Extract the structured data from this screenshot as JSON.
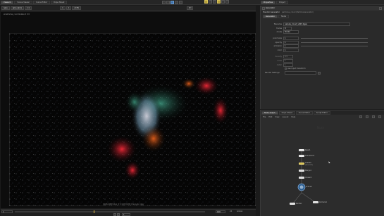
{
  "menubar": {
    "tabs": [
      "Viewer1",
      "Scene Viewer",
      "Curve Editor",
      "Dope Sheet",
      "Pixel Analyzer",
      "Project Settings",
      "Background Render",
      "Script Editor"
    ],
    "right_tabs": [
      "Properties",
      "Project"
    ],
    "frame_field": "1"
  },
  "viewer": {
    "toolbar": {
      "channels": "rgba",
      "channel2": "rgba.alpha",
      "zoom": "1:1",
      "exposure": "1",
      "gamma": "1",
      "colorspace": "ACES",
      "view_mode": "2D"
    },
    "format_label": "wireframe_coordinates 0 0 0",
    "bottom_label": "1920x1080 bbox: 0 0 1920 1080 channels: rgba"
  },
  "timeline": {
    "start": "1",
    "end": "100",
    "current": "1",
    "fps": "24",
    "mode": "Global",
    "playback": "Nuke"
  },
  "properties": {
    "node_name": "Generator",
    "node_type": "Houdini Generator",
    "node_subtitle": "particles_cloud (ParticleGenerator)",
    "tabs": [
      "Generator",
      "Node"
    ],
    "fields": [
      {
        "label": "filename",
        "value": "nebula_cloud_v003.bgeo"
      },
      {
        "label": "frame",
        "value": "0"
      },
      {
        "label": "mode",
        "value": "Points"
      },
      {
        "label": "point size",
        "value": "1"
      },
      {
        "label": "opacity",
        "value": "1"
      },
      {
        "label": "emission",
        "value": "1"
      },
      {
        "label": "color",
        "value": "1"
      },
      {
        "label": "density",
        "value": "0.5"
      },
      {
        "label": "scale",
        "value": "1"
      },
      {
        "label": "detail",
        "value": "1"
      }
    ],
    "checkbox_label": "use input transform",
    "button_label": "Render Settings"
  },
  "nodegraph": {
    "tabs": [
      "Node Graph",
      "Dope Sheet",
      "Curve Editor",
      "Script Editor"
    ],
    "menu": [
      "File",
      "Edit",
      "View",
      "Layout",
      "Help"
    ],
    "watermark": "Nuke",
    "nodes": [
      {
        "name": "Read1",
        "sub": ""
      },
      {
        "name": "Transform1",
        "sub": ""
      },
      {
        "name": "Grade1",
        "sub": "(mix 0.5)"
      },
      {
        "name": "Merge1",
        "sub": ""
      },
      {
        "name": "Viewer1",
        "sub": ""
      },
      {
        "name": "Scene1",
        "sub": ""
      },
      {
        "name": "Render",
        "sub": ""
      },
      {
        "name": "Camera1",
        "sub": ""
      }
    ]
  }
}
